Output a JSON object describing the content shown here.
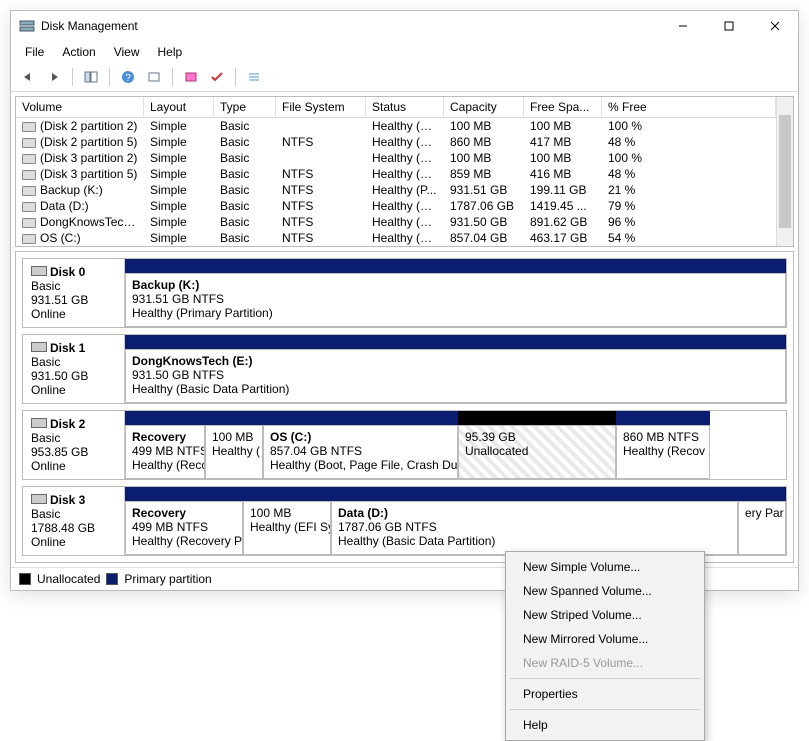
{
  "title": "Disk Management",
  "menu": {
    "file": "File",
    "action": "Action",
    "view": "View",
    "help": "Help"
  },
  "columns": {
    "volume": "Volume",
    "layout": "Layout",
    "type": "Type",
    "fs": "File System",
    "status": "Status",
    "capacity": "Capacity",
    "free": "Free Spa...",
    "pct": "% Free"
  },
  "volumes": [
    {
      "name": "(Disk 2 partition 2)",
      "layout": "Simple",
      "type": "Basic",
      "fs": "",
      "status": "Healthy (E...",
      "cap": "100 MB",
      "free": "100 MB",
      "pct": "100 %"
    },
    {
      "name": "(Disk 2 partition 5)",
      "layout": "Simple",
      "type": "Basic",
      "fs": "NTFS",
      "status": "Healthy (R...",
      "cap": "860 MB",
      "free": "417 MB",
      "pct": "48 %"
    },
    {
      "name": "(Disk 3 partition 2)",
      "layout": "Simple",
      "type": "Basic",
      "fs": "",
      "status": "Healthy (E...",
      "cap": "100 MB",
      "free": "100 MB",
      "pct": "100 %"
    },
    {
      "name": "(Disk 3 partition 5)",
      "layout": "Simple",
      "type": "Basic",
      "fs": "NTFS",
      "status": "Healthy (R...",
      "cap": "859 MB",
      "free": "416 MB",
      "pct": "48 %"
    },
    {
      "name": "Backup (K:)",
      "layout": "Simple",
      "type": "Basic",
      "fs": "NTFS",
      "status": "Healthy (P...",
      "cap": "931.51 GB",
      "free": "199.11 GB",
      "pct": "21 %"
    },
    {
      "name": "Data (D:)",
      "layout": "Simple",
      "type": "Basic",
      "fs": "NTFS",
      "status": "Healthy (B...",
      "cap": "1787.06 GB",
      "free": "1419.45 ...",
      "pct": "79 %"
    },
    {
      "name": "DongKnowsTech (...",
      "layout": "Simple",
      "type": "Basic",
      "fs": "NTFS",
      "status": "Healthy (B...",
      "cap": "931.50 GB",
      "free": "891.62 GB",
      "pct": "96 %"
    },
    {
      "name": "OS (C:)",
      "layout": "Simple",
      "type": "Basic",
      "fs": "NTFS",
      "status": "Healthy (B...",
      "cap": "857.04 GB",
      "free": "463.17 GB",
      "pct": "54 %"
    }
  ],
  "disks": [
    {
      "name": "Disk 0",
      "type": "Basic",
      "size": "931.51 GB",
      "state": "Online",
      "parts": [
        {
          "title": "Backup  (K:)",
          "l2": "931.51 GB NTFS",
          "l3": "Healthy (Primary Partition)",
          "flex": 1
        }
      ]
    },
    {
      "name": "Disk 1",
      "type": "Basic",
      "size": "931.50 GB",
      "state": "Online",
      "parts": [
        {
          "title": "DongKnowsTech  (E:)",
          "l2": "931.50 GB NTFS",
          "l3": "Healthy (Basic Data Partition)",
          "flex": 1
        }
      ]
    },
    {
      "name": "Disk 2",
      "type": "Basic",
      "size": "953.85 GB",
      "state": "Online",
      "parts": [
        {
          "title": "Recovery",
          "l2": "499 MB NTFS",
          "l3": "Healthy (Reco",
          "w": 80
        },
        {
          "title": "",
          "l2": "100 MB",
          "l3": "Healthy (",
          "w": 58
        },
        {
          "title": "OS  (C:)",
          "l2": "857.04 GB NTFS",
          "l3": "Healthy (Boot, Page File, Crash Du",
          "w": 195
        },
        {
          "title": "",
          "l2": "95.39 GB",
          "l3": "Unallocated",
          "w": 158,
          "unalloc": true
        },
        {
          "title": "",
          "l2": "860 MB NTFS",
          "l3": "Healthy (Recov",
          "w": 94
        }
      ],
      "strip": [
        {
          "c": "blue",
          "w": 80
        },
        {
          "c": "blue",
          "w": 58
        },
        {
          "c": "blue",
          "w": 195
        },
        {
          "c": "black",
          "w": 158
        },
        {
          "c": "blue",
          "w": 94
        }
      ]
    },
    {
      "name": "Disk 3",
      "type": "Basic",
      "size": "1788.48 GB",
      "state": "Online",
      "parts": [
        {
          "title": "Recovery",
          "l2": "499 MB NTFS",
          "l3": "Healthy (Recovery P",
          "w": 118
        },
        {
          "title": "",
          "l2": "100 MB",
          "l3": "Healthy (EFI Sy",
          "w": 88
        },
        {
          "title": "Data  (D:)",
          "l2": "1787.06 GB NTFS",
          "l3": "Healthy (Basic Data Partition)",
          "flex": 1
        },
        {
          "title": "",
          "l2": "",
          "l3": "ery Par",
          "w": 48
        }
      ]
    }
  ],
  "legend": {
    "unalloc": "Unallocated",
    "primary": "Primary partition"
  },
  "ctx": {
    "simple": "New Simple Volume...",
    "spanned": "New Spanned Volume...",
    "striped": "New Striped Volume...",
    "mirrored": "New Mirrored Volume...",
    "raid5": "New RAID-5 Volume...",
    "props": "Properties",
    "help": "Help"
  }
}
